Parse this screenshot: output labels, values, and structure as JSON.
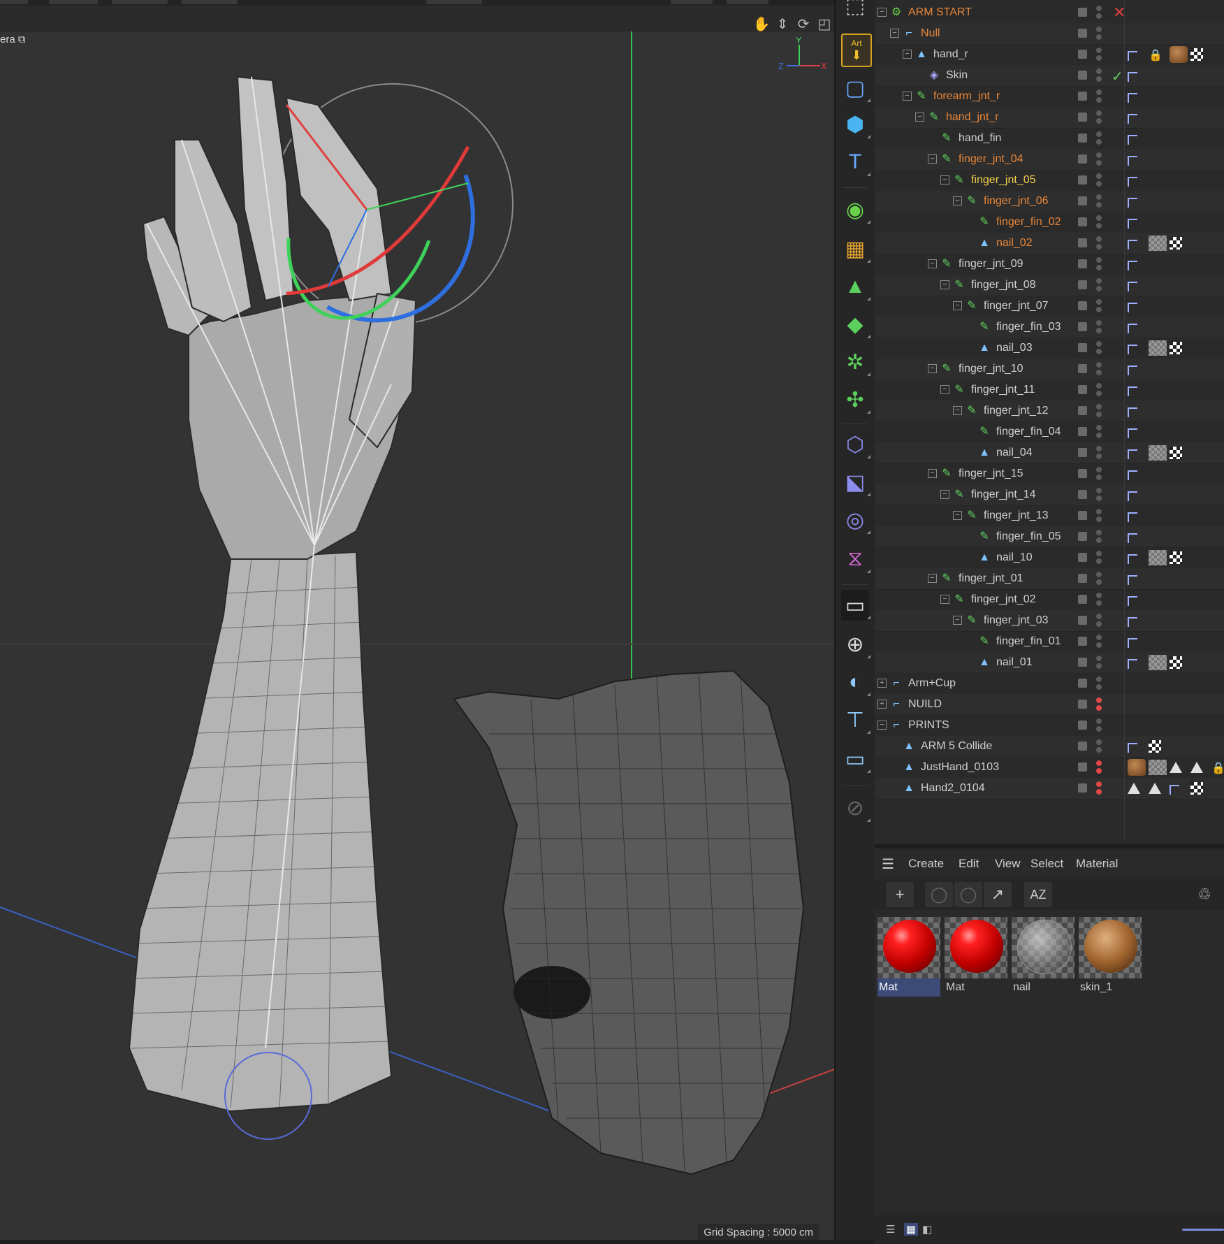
{
  "viewport": {
    "camera_label": "era",
    "grid_spacing": "Grid Spacing : 5000 cm",
    "axis_labels": {
      "y": "Y",
      "z": "Z",
      "x": "X"
    },
    "nav_icons": [
      "hand-pan-icon",
      "move-icon",
      "rotate-icon",
      "maximize-icon"
    ]
  },
  "palette": {
    "tools": [
      "cloner-icon",
      "art-tag-icon",
      "rectangle-spline-icon",
      "cube-icon",
      "text-icon",
      "null-generator-icon",
      "mograph-blocks-icon",
      "field-icon",
      "deformer-icon",
      "effector-gear-icon",
      "joint-icon",
      "spline-shape-icon",
      "hierarchy-icon",
      "sound-field-icon",
      "volume-icon",
      "floor-scene-icon",
      "sky-sphere-icon",
      "light-icon",
      "spot-icon",
      "camera-icon",
      "edit-pen-icon"
    ],
    "art_label": "Art"
  },
  "objects": [
    {
      "name": "ARM START",
      "depth": 0,
      "icon": "group-gear-icon",
      "color": "#e8873a",
      "expander": "−",
      "extra": "close"
    },
    {
      "name": "Null",
      "depth": 1,
      "icon": "null-icon",
      "color": "#e8873a",
      "expander": "−"
    },
    {
      "name": "hand_r",
      "depth": 2,
      "icon": "polygon-object-icon",
      "color": "#d0d0d0",
      "expander": "−",
      "tags": [
        "flag",
        "lock",
        "wood",
        "check"
      ]
    },
    {
      "name": "Skin",
      "depth": 3,
      "icon": "skin-deformer-icon",
      "color": "#d0d0d0",
      "tags": [
        "flag"
      ],
      "extra": "checkmark"
    },
    {
      "name": "forearm_jnt_r",
      "depth": 2,
      "icon": "joint-icon",
      "color": "#e8873a",
      "expander": "−",
      "tags": [
        "flag"
      ]
    },
    {
      "name": "hand_jnt_r",
      "depth": 3,
      "icon": "joint-icon",
      "color": "#e8873a",
      "expander": "−",
      "tags": [
        "flag"
      ]
    },
    {
      "name": "hand_fin",
      "depth": 4,
      "icon": "joint-icon",
      "color": "#d0d0d0",
      "tags": [
        "flag"
      ]
    },
    {
      "name": "finger_jnt_04",
      "depth": 4,
      "icon": "joint-icon",
      "color": "#e8873a",
      "expander": "−",
      "tags": [
        "flag"
      ]
    },
    {
      "name": "finger_jnt_05",
      "depth": 5,
      "icon": "joint-icon",
      "color": "#f2d04a",
      "expander": "−",
      "tags": [
        "flag"
      ]
    },
    {
      "name": "finger_jnt_06",
      "depth": 6,
      "icon": "joint-icon",
      "color": "#e8873a",
      "expander": "−",
      "tags": [
        "flag"
      ]
    },
    {
      "name": "finger_fin_02",
      "depth": 7,
      "icon": "joint-icon",
      "color": "#e8873a",
      "tags": [
        "flag"
      ]
    },
    {
      "name": "nail_02",
      "depth": 7,
      "icon": "polygon-object-icon",
      "color": "#e8873a",
      "tags": [
        "flag",
        "gray",
        "check"
      ]
    },
    {
      "name": "finger_jnt_09",
      "depth": 4,
      "icon": "joint-icon",
      "color": "#d0d0d0",
      "expander": "−",
      "tags": [
        "flag"
      ]
    },
    {
      "name": "finger_jnt_08",
      "depth": 5,
      "icon": "joint-icon",
      "color": "#d0d0d0",
      "expander": "−",
      "tags": [
        "flag"
      ]
    },
    {
      "name": "finger_jnt_07",
      "depth": 6,
      "icon": "joint-icon",
      "color": "#d0d0d0",
      "expander": "−",
      "tags": [
        "flag"
      ]
    },
    {
      "name": "finger_fin_03",
      "depth": 7,
      "icon": "joint-icon",
      "color": "#d0d0d0",
      "tags": [
        "flag"
      ]
    },
    {
      "name": "nail_03",
      "depth": 7,
      "icon": "polygon-object-icon",
      "color": "#d0d0d0",
      "tags": [
        "flag",
        "gray",
        "check"
      ]
    },
    {
      "name": "finger_jnt_10",
      "depth": 4,
      "icon": "joint-icon",
      "color": "#d0d0d0",
      "expander": "−",
      "tags": [
        "flag"
      ]
    },
    {
      "name": "finger_jnt_11",
      "depth": 5,
      "icon": "joint-icon",
      "color": "#d0d0d0",
      "expander": "−",
      "tags": [
        "flag"
      ]
    },
    {
      "name": "finger_jnt_12",
      "depth": 6,
      "icon": "joint-icon",
      "color": "#d0d0d0",
      "expander": "−",
      "tags": [
        "flag"
      ]
    },
    {
      "name": "finger_fin_04",
      "depth": 7,
      "icon": "joint-icon",
      "color": "#d0d0d0",
      "tags": [
        "flag"
      ]
    },
    {
      "name": "nail_04",
      "depth": 7,
      "icon": "polygon-object-icon",
      "color": "#d0d0d0",
      "tags": [
        "flag",
        "gray",
        "check"
      ]
    },
    {
      "name": "finger_jnt_15",
      "depth": 4,
      "icon": "joint-icon",
      "color": "#d0d0d0",
      "expander": "−",
      "tags": [
        "flag"
      ]
    },
    {
      "name": "finger_jnt_14",
      "depth": 5,
      "icon": "joint-icon",
      "color": "#d0d0d0",
      "expander": "−",
      "tags": [
        "flag"
      ]
    },
    {
      "name": "finger_jnt_13",
      "depth": 6,
      "icon": "joint-icon",
      "color": "#d0d0d0",
      "expander": "−",
      "tags": [
        "flag"
      ]
    },
    {
      "name": "finger_fin_05",
      "depth": 7,
      "icon": "joint-icon",
      "color": "#d0d0d0",
      "tags": [
        "flag"
      ]
    },
    {
      "name": "nail_10",
      "depth": 7,
      "icon": "polygon-object-icon",
      "color": "#d0d0d0",
      "tags": [
        "flag",
        "gray",
        "check"
      ]
    },
    {
      "name": "finger_jnt_01",
      "depth": 4,
      "icon": "joint-icon",
      "color": "#d0d0d0",
      "expander": "−",
      "tags": [
        "flag"
      ]
    },
    {
      "name": "finger_jnt_02",
      "depth": 5,
      "icon": "joint-icon",
      "color": "#d0d0d0",
      "expander": "−",
      "tags": [
        "flag"
      ]
    },
    {
      "name": "finger_jnt_03",
      "depth": 6,
      "icon": "joint-icon",
      "color": "#d0d0d0",
      "expander": "−",
      "tags": [
        "flag"
      ]
    },
    {
      "name": "finger_fin_01",
      "depth": 7,
      "icon": "joint-icon",
      "color": "#d0d0d0",
      "tags": [
        "flag"
      ]
    },
    {
      "name": "nail_01",
      "depth": 7,
      "icon": "polygon-object-icon",
      "color": "#d0d0d0",
      "tags": [
        "flag",
        "gray",
        "check"
      ]
    },
    {
      "name": "Arm+Cup",
      "depth": 0,
      "icon": "null-icon",
      "color": "#d0d0d0",
      "expander": "+"
    },
    {
      "name": "NUILD",
      "depth": 0,
      "icon": "null-icon",
      "color": "#d0d0d0",
      "expander": "+",
      "dot": "red"
    },
    {
      "name": "PRINTS",
      "depth": 0,
      "icon": "null-icon",
      "color": "#d0d0d0",
      "expander": "−"
    },
    {
      "name": "ARM 5 Collide",
      "depth": 1,
      "icon": "polygon-object-icon",
      "color": "#d0d0d0",
      "tags": [
        "flag",
        "check"
      ]
    },
    {
      "name": "JustHand_0103",
      "depth": 1,
      "icon": "polygon-object-icon",
      "color": "#d0d0d0",
      "dot": "red",
      "tags": [
        "wood",
        "gray",
        "tri",
        "tri",
        "lock"
      ]
    },
    {
      "name": "Hand2_0104",
      "depth": 1,
      "icon": "polygon-object-icon",
      "color": "#d0d0d0",
      "dot": "red",
      "tags": [
        "tri",
        "tri",
        "flag",
        "check"
      ]
    }
  ],
  "material_manager": {
    "menu": [
      "Create",
      "Edit",
      "View",
      "Select",
      "Material"
    ],
    "toolbar": [
      "add-icon",
      "sphere-preview-icon",
      "sphere-preview-icon",
      "arrow-icon",
      "sort-az-icon",
      "recycle-icon"
    ],
    "sort_label": "AZ",
    "materials": [
      {
        "name": "Mat",
        "kind": "red",
        "selected": true
      },
      {
        "name": "Mat",
        "kind": "red",
        "selected": false
      },
      {
        "name": "nail",
        "kind": "glass",
        "selected": false
      },
      {
        "name": "skin_1",
        "kind": "wood",
        "selected": false
      }
    ],
    "view_buttons": [
      "list-view-icon",
      "grid-view-icon",
      "single-view-icon"
    ]
  },
  "colors": {
    "accent_orange": "#e8873a",
    "highlight_yellow": "#f2d04a",
    "joint_green": "#5fd35f",
    "selection_blue": "#3c4a78"
  }
}
